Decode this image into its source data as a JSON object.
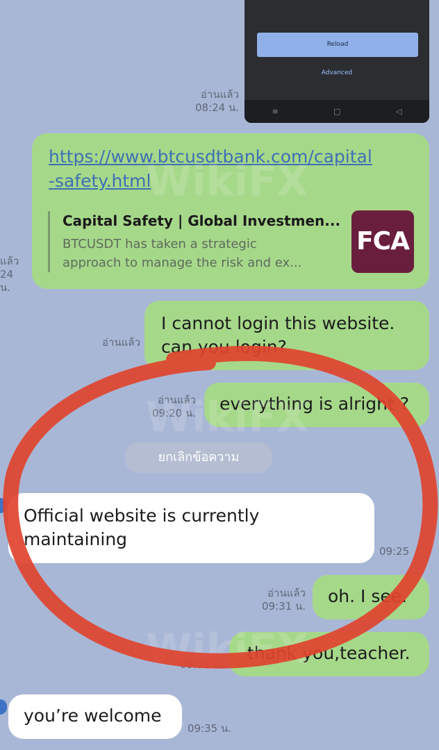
{
  "embedded_screenshot": {
    "reload_label": "Reload",
    "advanced_label": "Advanced",
    "nav_icons": [
      "menu-icon",
      "home-icon",
      "back-icon"
    ]
  },
  "messages": [
    {
      "id": "m_shot",
      "read": "อ่านแล้ว",
      "time": "08:24 น."
    },
    {
      "id": "m_link",
      "link_line1": "https://www.btcusdtbank.com/capital",
      "link_line2": "-safety.html",
      "preview_title": "Capital Safety | Global Investmen...",
      "preview_desc_line1": "BTCUSDT has taken a strategic",
      "preview_desc_line2": "approach to manage the risk and ex...",
      "badge": "FCA",
      "read_partial": "แล้ว",
      "time_partial": "24 น."
    },
    {
      "id": "m_login",
      "line1": "I cannot login this website.",
      "line2": "can you login?",
      "read": "อ่านแล้ว"
    },
    {
      "id": "m_alright",
      "text": "everything is alright ?",
      "read": "อ่านแล้ว",
      "time": "09:20 น."
    },
    {
      "id": "m_unsend",
      "text": "ยกเลิกข้อความ"
    },
    {
      "id": "m_official",
      "line1": "Official website is currently",
      "line2": "maintaining",
      "time": "09:25"
    },
    {
      "id": "m_ohisee",
      "text": "oh. I see.",
      "read": "อ่านแล้ว",
      "time": "09:31 น."
    },
    {
      "id": "m_thanks",
      "text": "thank you,teacher.",
      "time": "09:31 น."
    },
    {
      "id": "m_welcome",
      "text": "you’re welcome",
      "time": "09:35 น."
    }
  ],
  "watermark_text": "WikiFX",
  "colors": {
    "background": "#a9b7d6",
    "outgoing_bubble": "#a6d88a",
    "incoming_bubble": "#ffffff",
    "annotation": "#e0432e",
    "fca_badge": "#6a1e3e"
  }
}
